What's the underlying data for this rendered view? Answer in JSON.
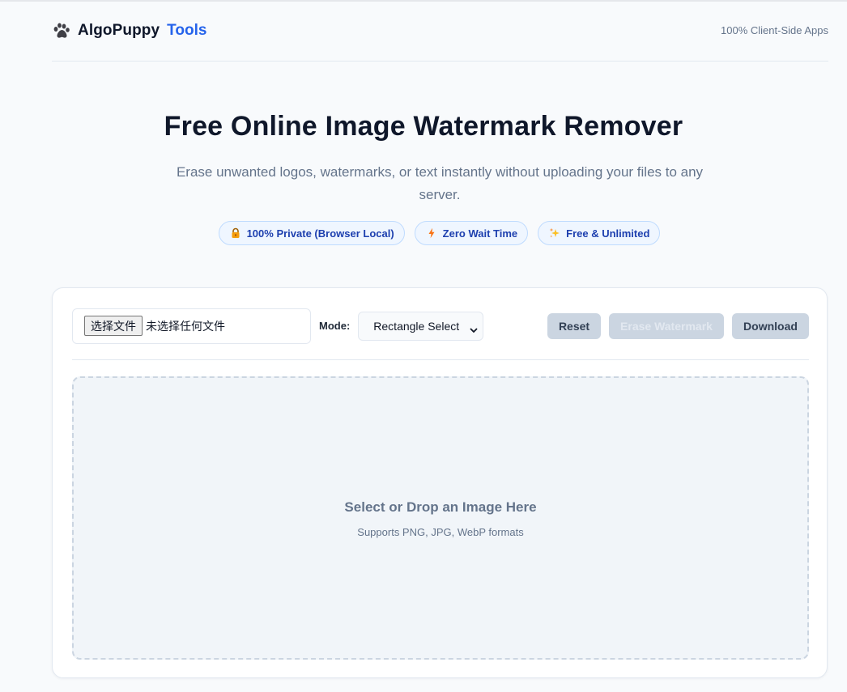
{
  "header": {
    "brand_name": "AlgoPuppy",
    "brand_accent": "Tools",
    "right_text": "100% Client-Side Apps"
  },
  "hero": {
    "title": "Free Online Image Watermark Remover",
    "subtitle": "Erase unwanted logos, watermarks, or text instantly without uploading your files to any server."
  },
  "badges": [
    {
      "icon": "lock-icon",
      "label": "100% Private (Browser Local)"
    },
    {
      "icon": "lightning-icon",
      "label": "Zero Wait Time"
    },
    {
      "icon": "sparkles-icon",
      "label": "Free & Unlimited"
    }
  ],
  "toolbar": {
    "file_button_label": "选择文件",
    "file_status": "未选择任何文件",
    "mode_label": "Mode:",
    "mode_selected": "Rectangle Select",
    "reset_label": "Reset",
    "erase_label": "Erase Watermark",
    "download_label": "Download"
  },
  "dropzone": {
    "title": "Select or Drop an Image Here",
    "subtitle": "Supports PNG, JPG, WebP formats"
  },
  "colors": {
    "accent": "#2563eb",
    "badge_text": "#1e40af",
    "badge_bg": "#eff6ff",
    "button_bg": "#cbd5e1",
    "muted_text": "#64748b"
  }
}
